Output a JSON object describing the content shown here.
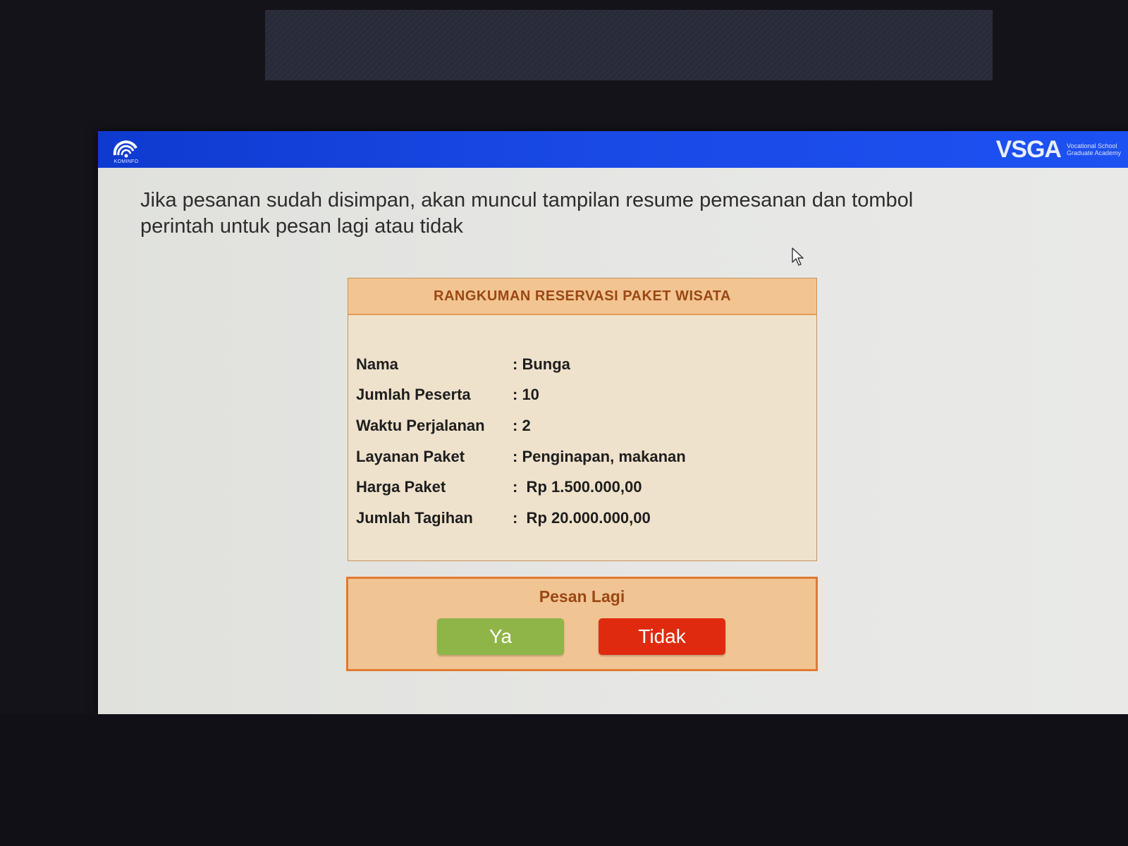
{
  "header": {
    "logo_caption": "KOMINFO",
    "brand_name": "VSGA",
    "brand_sub_line1": "Vocational School",
    "brand_sub_line2": "Graduate Academy"
  },
  "instruction": "Jika  pesanan sudah disimpan, akan muncul tampilan resume pemesanan dan tombol perintah untuk pesan lagi atau tidak",
  "summary": {
    "title": "RANGKUMAN RESERVASI PAKET WISATA",
    "rows": [
      {
        "label": "Nama",
        "value": ": Bunga"
      },
      {
        "label": "Jumlah Peserta",
        "value": ": 10"
      },
      {
        "label": "Waktu Perjalanan",
        "value": ": 2"
      },
      {
        "label": "Layanan Paket",
        "value": ": Penginapan, makanan"
      },
      {
        "label": "Harga Paket",
        "value": ":  Rp 1.500.000,00"
      },
      {
        "label": "Jumlah Tagihan",
        "value": ":  Rp 20.000.000,00"
      }
    ]
  },
  "order_again": {
    "prompt": "Pesan Lagi",
    "yes_label": "Ya",
    "no_label": "Tidak"
  },
  "colors": {
    "header_blue": "#1a4ae6",
    "summary_bg": "#efe2cc",
    "title_bar": "#f2c491",
    "accent_orange": "#e27a2f",
    "yes_green": "#8fb548",
    "no_red": "#e02a0f"
  }
}
